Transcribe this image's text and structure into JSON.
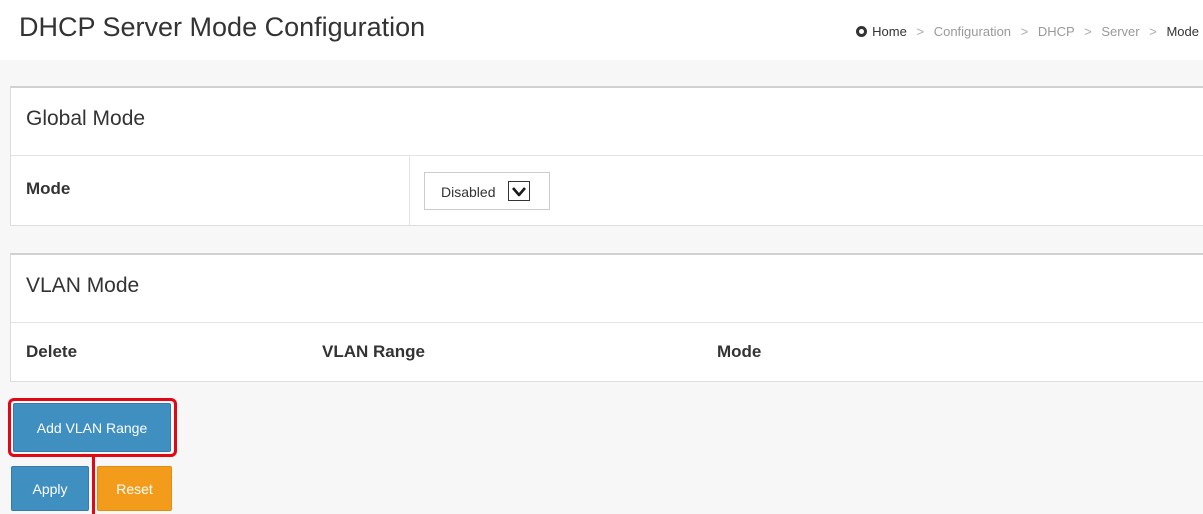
{
  "page": {
    "title": "DHCP Server Mode Configuration"
  },
  "breadcrumb": {
    "items": [
      "Home",
      "Configuration",
      "DHCP",
      "Server",
      "Mode"
    ],
    "separator": ">"
  },
  "global_mode": {
    "heading": "Global Mode",
    "mode_label": "Mode",
    "mode_value": "Disabled"
  },
  "vlan_mode": {
    "heading": "VLAN Mode",
    "columns": [
      "Delete",
      "VLAN Range",
      "Mode"
    ]
  },
  "buttons": {
    "add_vlan_range": "Add VLAN Range",
    "apply": "Apply",
    "reset": "Reset"
  },
  "colors": {
    "primary_button": "#3f8fc1",
    "reset_button": "#f39c1b",
    "highlight": "#e30613"
  },
  "icons": {
    "home": "home-icon",
    "select_arrow": "chevron-down-icon"
  }
}
